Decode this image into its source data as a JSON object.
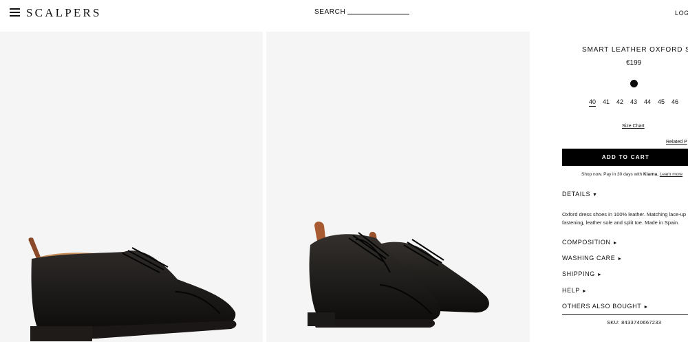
{
  "header": {
    "logo": "SCALPERS",
    "search_label": "SEARCH",
    "login_label": "LOGI"
  },
  "gallery": {
    "images": [
      {
        "alt": "black oxford shoe side view"
      },
      {
        "alt": "pair of black oxford shoes"
      }
    ]
  },
  "product": {
    "title": "SMART LEATHER OXFORD SHOES",
    "price": "€199",
    "color": "#0d0d0d",
    "sizes": [
      "40",
      "41",
      "42",
      "43",
      "44",
      "45",
      "46"
    ],
    "selected_size": "40",
    "size_chart_label": "Size Chart",
    "related_label": "Related P",
    "add_to_cart_label": "ADD TO CART",
    "klarna": {
      "prefix": "Shop now. Pay in 30 days with",
      "brand": "Klarna.",
      "link": "Learn more"
    },
    "details_label": "DETAILS",
    "details_arrow": "▼",
    "description": "Oxford dress shoes in 100% leather. Matching lace-up fastening, leather sole and split toe. Made in Spain.",
    "sections": [
      {
        "label": "COMPOSITION",
        "arrow": "►"
      },
      {
        "label": "WASHING CARE",
        "arrow": "►"
      },
      {
        "label": "SHIPPING",
        "arrow": "►"
      },
      {
        "label": "HELP",
        "arrow": "►"
      },
      {
        "label": "OTHERS ALSO BOUGHT",
        "arrow": "►"
      }
    ],
    "sku": "SKU: 8433740667233"
  }
}
